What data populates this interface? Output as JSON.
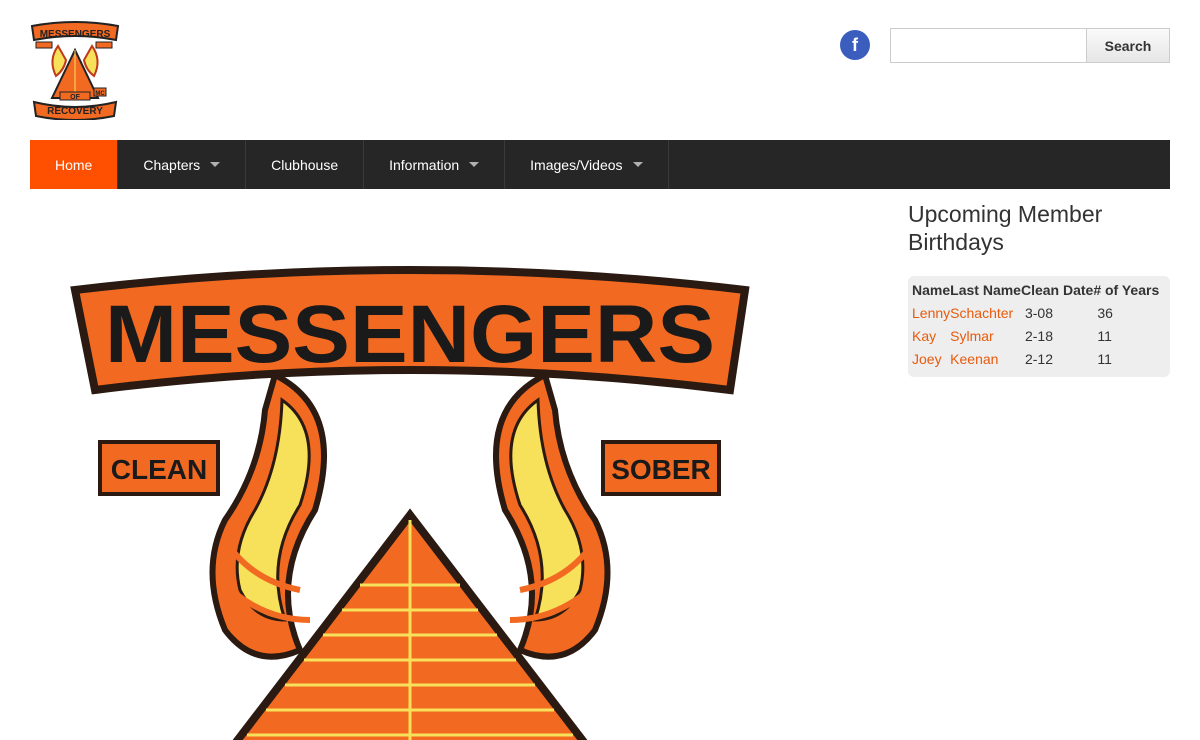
{
  "header": {
    "logo_text": {
      "top": "MESSENGERS",
      "bottom1": "OF",
      "bottom2": "RECOVERY",
      "mc": "MC"
    },
    "social_icon": "facebook-icon",
    "social_glyph": "f",
    "search": {
      "placeholder": "",
      "value": "",
      "button_label": "Search"
    }
  },
  "nav": {
    "items": [
      {
        "label": "Home",
        "active": true,
        "dropdown": false
      },
      {
        "label": "Chapters",
        "active": false,
        "dropdown": true
      },
      {
        "label": "Clubhouse",
        "active": false,
        "dropdown": false
      },
      {
        "label": "Information",
        "active": false,
        "dropdown": true
      },
      {
        "label": "Images/Videos",
        "active": false,
        "dropdown": true
      }
    ]
  },
  "hero": {
    "banner_text": "MESSENGERS",
    "left_patch": "CLEAN",
    "right_patch": "SOBER"
  },
  "sidebar": {
    "title": "Upcoming Member Birthdays",
    "columns": [
      "Name",
      "Last Name",
      "Clean Date",
      "# of Years"
    ],
    "rows": [
      {
        "first": "Lenny",
        "last": "Schachter",
        "date": "3-08",
        "years": "36"
      },
      {
        "first": "Kay",
        "last": "Sylmar",
        "date": "2-18",
        "years": "11"
      },
      {
        "first": "Joey",
        "last": "Keenan",
        "date": "2-12",
        "years": "11"
      }
    ]
  },
  "colors": {
    "accent": "#ff4f00",
    "nav_bg": "#262626",
    "link": "#e85a0c",
    "patch_orange": "#f26a21",
    "wing_yellow": "#f7e05a"
  }
}
